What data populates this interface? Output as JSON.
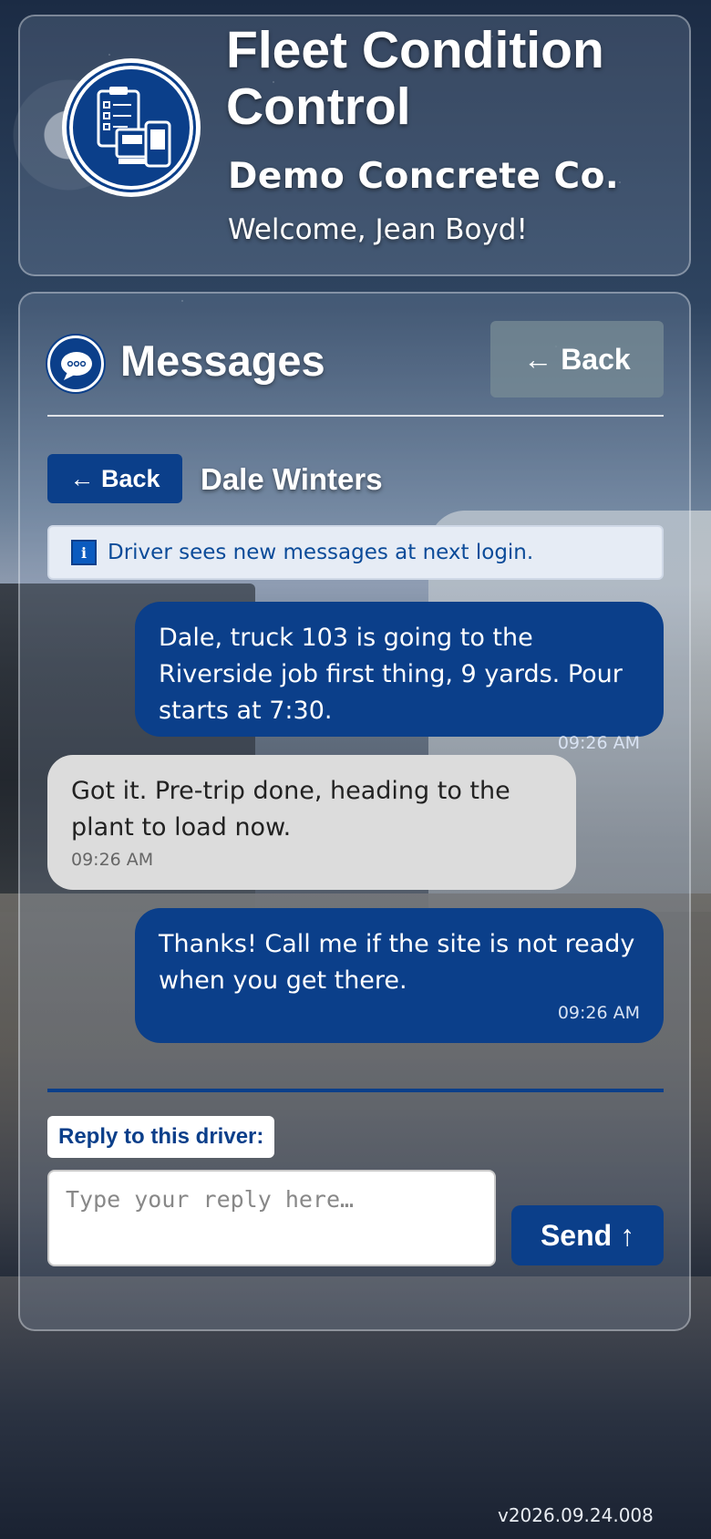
{
  "header": {
    "app_title": "Fleet Condition Control",
    "company": "Demo Concrete Co.",
    "welcome": "Welcome, Jean Boyd!",
    "logo_icon": "clipboard-truck-phone-icon"
  },
  "messages_section": {
    "title": "Messages",
    "icon": "chat-bubble-icon",
    "back_label": "← Back"
  },
  "thread": {
    "back_label": "← Back",
    "driver_name": "Dale Winters",
    "info_icon": "info-icon",
    "info_text": "Driver sees new messages at next login.",
    "messages": [
      {
        "direction": "outgoing",
        "text": "Dale, truck 103 is going to the Riverside job first thing, 9 yards. Pour starts at 7:30.",
        "time": "09:26 AM"
      },
      {
        "direction": "incoming",
        "text": "Got it. Pre-trip done, heading to the plant to load now.",
        "time": "09:26 AM"
      },
      {
        "direction": "outgoing",
        "text": "Thanks! Call me if the site is not ready when you get there.",
        "time": "09:26 AM"
      }
    ]
  },
  "reply": {
    "label": "Reply to this driver:",
    "placeholder": "Type your reply here…",
    "value": "",
    "send_label": "Send ↑"
  },
  "footer": {
    "version": "v2026.09.24.008"
  },
  "colors": {
    "brand_blue": "#0b3f8a",
    "incoming_bubble": "#dcdcdc",
    "info_bg": "#e6ecf5",
    "back_button_muted": "#7f8e98"
  }
}
